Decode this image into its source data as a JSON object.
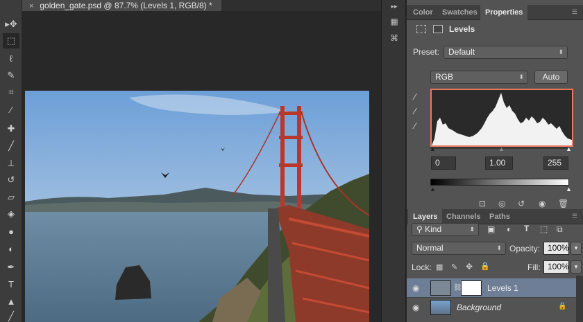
{
  "document": {
    "tab_title": "golden_gate.psd @ 87.7% (Levels 1, RGB/8) *",
    "close_glyph": "×"
  },
  "tools": [
    {
      "icon": "move-tool-icon",
      "glyph": "▸✥"
    },
    {
      "icon": "marquee-tool-icon",
      "glyph": "⬚"
    },
    {
      "icon": "lasso-tool-icon",
      "glyph": "ℓ"
    },
    {
      "icon": "quick-select-tool-icon",
      "glyph": "✎"
    },
    {
      "icon": "crop-tool-icon",
      "glyph": "⌗"
    },
    {
      "icon": "eyedropper-tool-icon",
      "glyph": "⁄"
    },
    {
      "icon": "healing-brush-tool-icon",
      "glyph": "✚"
    },
    {
      "icon": "brush-tool-icon",
      "glyph": "╱"
    },
    {
      "icon": "clone-stamp-tool-icon",
      "glyph": "⊥"
    },
    {
      "icon": "history-brush-tool-icon",
      "glyph": "↺"
    },
    {
      "icon": "eraser-tool-icon",
      "glyph": "▱"
    },
    {
      "icon": "paint-bucket-tool-icon",
      "glyph": "◈"
    },
    {
      "icon": "blur-tool-icon",
      "glyph": "●"
    },
    {
      "icon": "dodge-tool-icon",
      "glyph": "◐"
    },
    {
      "icon": "pen-tool-icon",
      "glyph": "✒"
    },
    {
      "icon": "type-tool-icon",
      "glyph": "T"
    },
    {
      "icon": "path-select-tool-icon",
      "glyph": "▲"
    },
    {
      "icon": "line-tool-icon",
      "glyph": "╱"
    }
  ],
  "upper_panel": {
    "tabs": [
      "Color",
      "Swatches",
      "Properties"
    ],
    "active_tab": "Properties",
    "title": "Levels",
    "preset_label": "Preset:",
    "preset_value": "Default",
    "channel_value": "RGB",
    "auto_label": "Auto",
    "input_black": "0",
    "input_gamma": "1.00",
    "input_white": "255"
  },
  "layers_panel": {
    "tabs": [
      "Layers",
      "Channels",
      "Paths"
    ],
    "active_tab": "Layers",
    "filter_kind": "Kind",
    "blend_mode": "Normal",
    "opacity_label": "Opacity:",
    "opacity_value": "100%",
    "lock_label": "Lock:",
    "fill_label": "Fill:",
    "fill_value": "100%",
    "layers": [
      {
        "name": "Levels 1",
        "selected": true
      },
      {
        "name": "Background",
        "selected": false,
        "locked": true
      }
    ]
  },
  "colors": {
    "highlight_outline": "#e87a5f",
    "selected_layer": "#6d7e96"
  }
}
